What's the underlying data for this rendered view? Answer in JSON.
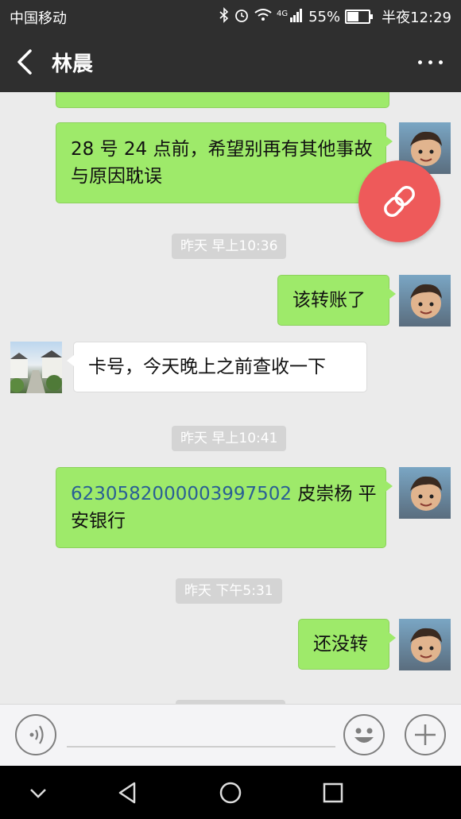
{
  "status_bar": {
    "carrier": "中国移动",
    "network": "4G",
    "battery": "55%",
    "time": "半夜12:29"
  },
  "header": {
    "title": "林晨",
    "back_icon": "chevron-left-icon",
    "more_icon": "more-dots-icon"
  },
  "messages": {
    "m1": {
      "text": "28 号 24 点前，希望别再有其他事故与原因耽误"
    },
    "ts1": "昨天 早上10:36",
    "m2": {
      "text": "该转账了"
    },
    "m3": {
      "text": "卡号，今天晚上之前查收一下"
    },
    "ts2": "昨天 早上10:41",
    "m4": {
      "link": "6230582000003997502",
      "text": " 皮崇杨 平安银行"
    },
    "ts3": "昨天 下午5:31",
    "m5": {
      "text": "还没转"
    }
  },
  "floating_button": {
    "icon": "link-icon",
    "color": "#ee5a5a"
  },
  "input_bar": {
    "voice_icon": "voice-icon",
    "message_value": "",
    "emoji_icon": "emoji-icon",
    "add_icon": "plus-icon"
  },
  "nav_bar": {
    "back": "back-triangle-icon",
    "home": "home-circle-icon",
    "recent": "recent-square-icon"
  },
  "colors": {
    "header": "#2f2f2f",
    "bubble_green": "#9eea6a",
    "chat_bg": "#ebebeb",
    "link": "#2a5f95"
  }
}
